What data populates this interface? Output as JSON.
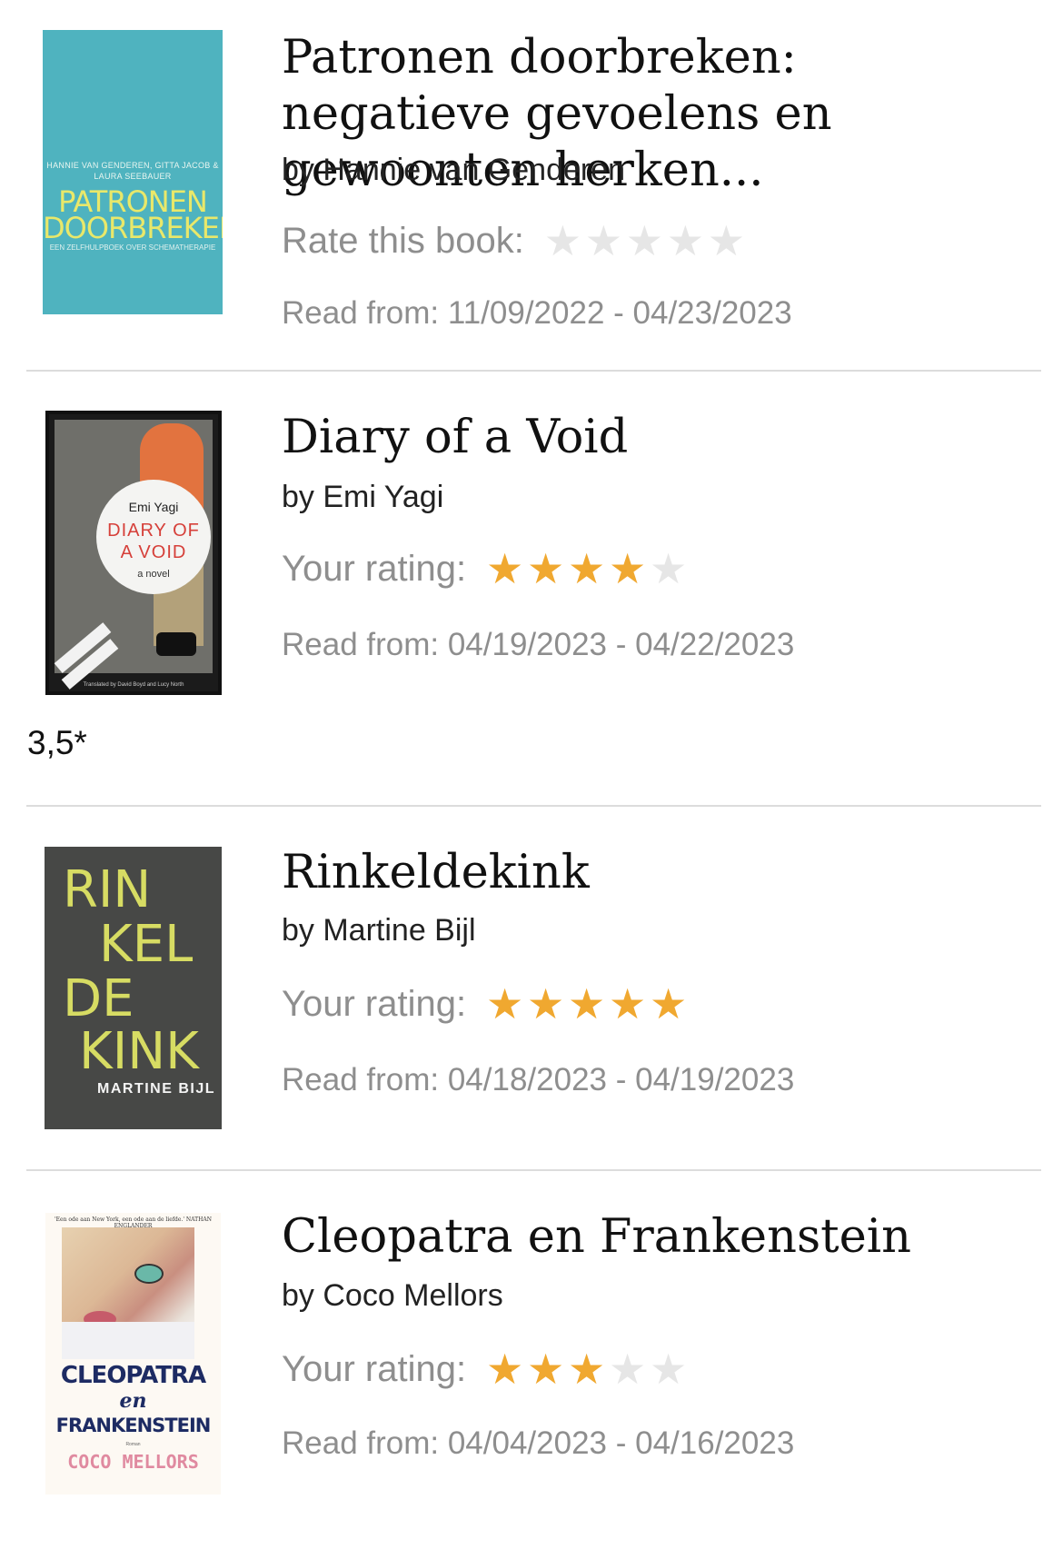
{
  "books": [
    {
      "title": "Patronen doorbreken: negatieve gevoelens en gewoonten herken...",
      "author": "by Hannie van Genderen",
      "rating_label": "Rate this book:",
      "rating": 0,
      "dates": "Read from: 11/09/2022 - 04/23/2023",
      "cover": {
        "authors": "HANNIE VAN GENDEREN, GITTA JACOB & LAURA SEEBAUER",
        "line1": "PATRONEN",
        "line2": "DOORBREKEN",
        "subtitle": "EEN ZELFHULPBOEK OVER SCHEMATHERAPIE",
        "color": "#4fb3bf"
      }
    },
    {
      "title": "Diary of a Void",
      "author": "by Emi Yagi",
      "rating_label": "Your rating:",
      "rating": 4,
      "dates": "Read from: 04/19/2023 - 04/22/2023",
      "note": "3,5*",
      "cover": {
        "author": "Emi Yagi",
        "line1": "DIARY OF",
        "line2": "A VOID",
        "novel": "a novel",
        "translated": "Translated by David Boyd and Lucy North"
      }
    },
    {
      "title": "Rinkeldekink",
      "author": "by Martine Bijl",
      "rating_label": "Your rating:",
      "rating": 5,
      "dates": "Read from: 04/18/2023 - 04/19/2023",
      "cover": {
        "w1": "RIN",
        "w2": "KEL",
        "w3": "DE",
        "w4": "KINK",
        "author": "MARTINE BIJL",
        "color": "#474846"
      }
    },
    {
      "title": "Cleopatra en Frankenstein",
      "author": "by Coco Mellors",
      "rating_label": "Your rating:",
      "rating": 3,
      "dates": "Read from: 04/04/2023 - 04/16/2023",
      "cover": {
        "blurb": "'Een ode aan New York, een ode aan de liefde.' NATHAN ENGLANDER",
        "t1": "CLEOPATRA",
        "t2": "en",
        "t3": "FRANKENSTEIN",
        "roman": "Roman",
        "author": "COCO MELLORS"
      }
    }
  ],
  "star_glyph": "★",
  "star_colors": {
    "on": "#f0a830",
    "off": "#e6e6e6"
  }
}
